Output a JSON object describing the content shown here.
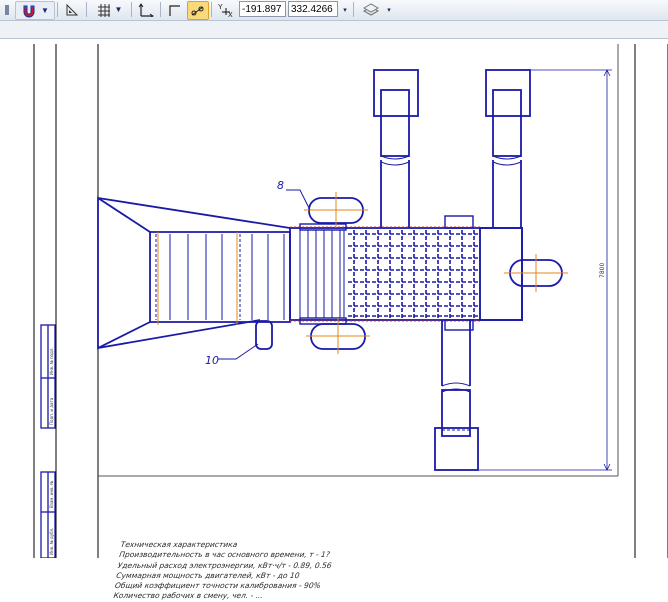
{
  "toolbar": {
    "coord_x": "-191.897",
    "coord_y": "332.4266",
    "buttons": [
      "magnet-icon",
      "triangle-corner-icon",
      "grid-icon",
      "axes-icon",
      "step-line-icon",
      "snap-nodes-icon",
      "cursor-xy-icon",
      "layers-icon"
    ]
  },
  "drawing": {
    "label_8": "8",
    "label_10": "10",
    "dimension_text": "7800",
    "notes": [
      "Техническая характеристика",
      "Производительность в час основного времени, т - 1?",
      "Удельный расход электроэнергии, кВт·ч/т - 0.89, 0.56",
      "Суммарная мощность двигателей, кВт - до 10",
      "Общий коэффициент точности калибрования - 90%",
      "Количество рабочих в смену, чел. - ..."
    ]
  },
  "colors": {
    "line": "#1a1aa8",
    "center": "#e08a1a",
    "frame": "#000000",
    "accent": "#d4462a"
  }
}
